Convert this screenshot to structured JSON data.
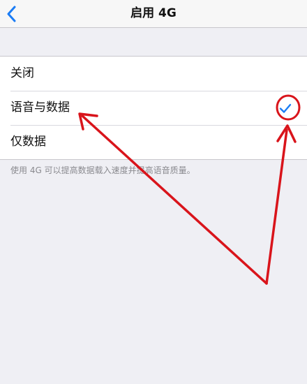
{
  "navbar": {
    "title": "启用 4G",
    "back_icon": "chevron-left-icon",
    "accent_color": "#1a7cf5"
  },
  "options": [
    {
      "label": "关闭",
      "selected": false
    },
    {
      "label": "语音与数据",
      "selected": true
    },
    {
      "label": "仅数据",
      "selected": false
    }
  ],
  "footer_text": "使用 4G 可以提高数据载入速度并提高语音质量。",
  "annotation": {
    "color": "#d9141b",
    "marks": [
      "check-circle",
      "arrow-to-option",
      "arrow-to-check"
    ]
  }
}
